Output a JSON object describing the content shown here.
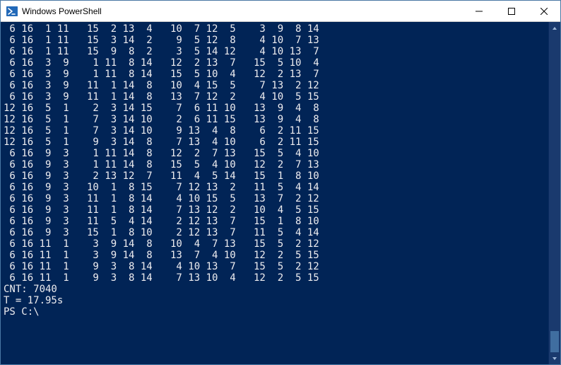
{
  "window": {
    "title": "Windows PowerShell"
  },
  "controls": {
    "minimize": "—",
    "maximize": "☐",
    "close": "✕"
  },
  "console": {
    "lines": [
      " 6 16  1 11   15  2 13  4   10  7 12  5    3  9  8 14",
      " 6 16  1 11   15  3 14  2    9  5 12  8    4 10  7 13",
      " 6 16  1 11   15  9  8  2    3  5 14 12    4 10 13  7",
      " 6 16  3  9    1 11  8 14   12  2 13  7   15  5 10  4",
      " 6 16  3  9    1 11  8 14   15  5 10  4   12  2 13  7",
      " 6 16  3  9   11  1 14  8   10  4 15  5    7 13  2 12",
      " 6 16  3  9   11  1 14  8   13  7 12  2    4 10  5 15",
      "12 16  5  1    2  3 14 15    7  6 11 10   13  9  4  8",
      "12 16  5  1    7  3 14 10    2  6 11 15   13  9  4  8",
      "12 16  5  1    7  3 14 10    9 13  4  8    6  2 11 15",
      "12 16  5  1    9  3 14  8    7 13  4 10    6  2 11 15",
      " 6 16  9  3    1 11 14  8   12  2  7 13   15  5  4 10",
      " 6 16  9  3    1 11 14  8   15  5  4 10   12  2  7 13",
      " 6 16  9  3    2 13 12  7   11  4  5 14   15  1  8 10",
      " 6 16  9  3   10  1  8 15    7 12 13  2   11  5  4 14",
      " 6 16  9  3   11  1  8 14    4 10 15  5   13  7  2 12",
      " 6 16  9  3   11  1  8 14    7 13 12  2   10  4  5 15",
      " 6 16  9  3   11  5  4 14    2 12 13  7   15  1  8 10",
      " 6 16  9  3   15  1  8 10    2 12 13  7   11  5  4 14",
      " 6 16 11  1    3  9 14  8   10  4  7 13   15  5  2 12",
      " 6 16 11  1    3  9 14  8   13  7  4 10   12  2  5 15",
      " 6 16 11  1    9  3  8 14    4 10 13  7   15  5  2 12",
      " 6 16 11  1    9  3  8 14    7 13 10  4   12  2  5 15",
      "CNT: 7040",
      "T = 17.95s",
      "PS C:\\"
    ]
  }
}
